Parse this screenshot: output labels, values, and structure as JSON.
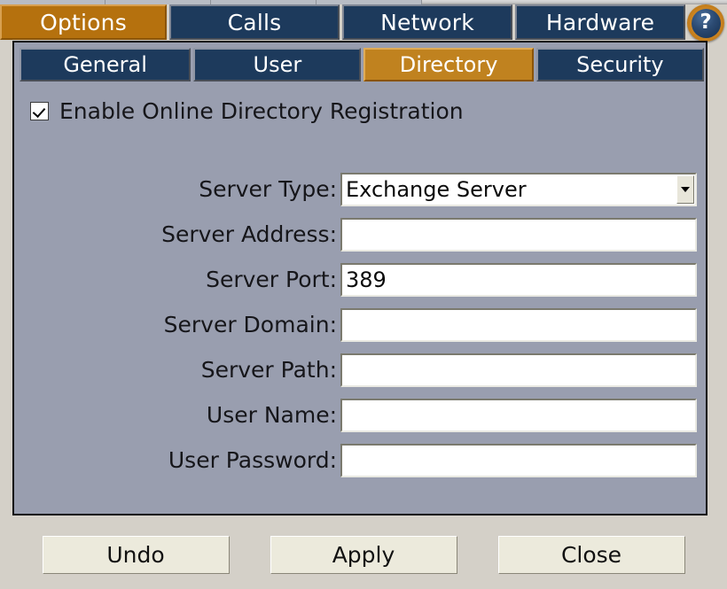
{
  "window": {
    "help_icon": "question-mark-icon",
    "help_label": "?"
  },
  "main_tabs": [
    {
      "label": "Options",
      "active": true
    },
    {
      "label": "Calls",
      "active": false
    },
    {
      "label": "Network",
      "active": false
    },
    {
      "label": "Hardware",
      "active": false
    }
  ],
  "sub_tabs": [
    {
      "label": "General",
      "active": false
    },
    {
      "label": "User",
      "active": false
    },
    {
      "label": "Directory",
      "active": true
    },
    {
      "label": "Security",
      "active": false
    }
  ],
  "checkbox": {
    "label": "Enable Online Directory Registration",
    "checked": true
  },
  "form": {
    "rows": [
      {
        "label": "Server Type:",
        "value": "Exchange Server",
        "type": "select"
      },
      {
        "label": "Server Address:",
        "value": "",
        "type": "text"
      },
      {
        "label": "Server Port:",
        "value": "389",
        "type": "text"
      },
      {
        "label": "Server Domain:",
        "value": "",
        "type": "text"
      },
      {
        "label": "Server Path:",
        "value": "",
        "type": "text"
      },
      {
        "label": "User Name:",
        "value": "",
        "type": "text"
      },
      {
        "label": "User Password:",
        "value": "",
        "type": "password"
      }
    ]
  },
  "buttons": [
    {
      "label": "Undo"
    },
    {
      "label": "Apply"
    },
    {
      "label": "Close"
    }
  ],
  "colors": {
    "accent_orange": "#b5710e",
    "tab_blue": "#1d3a5c",
    "panel_gray": "#999eaf",
    "window_gray": "#d4d0c8",
    "field_white": "#ffffff",
    "button_cream": "#eceadc"
  }
}
